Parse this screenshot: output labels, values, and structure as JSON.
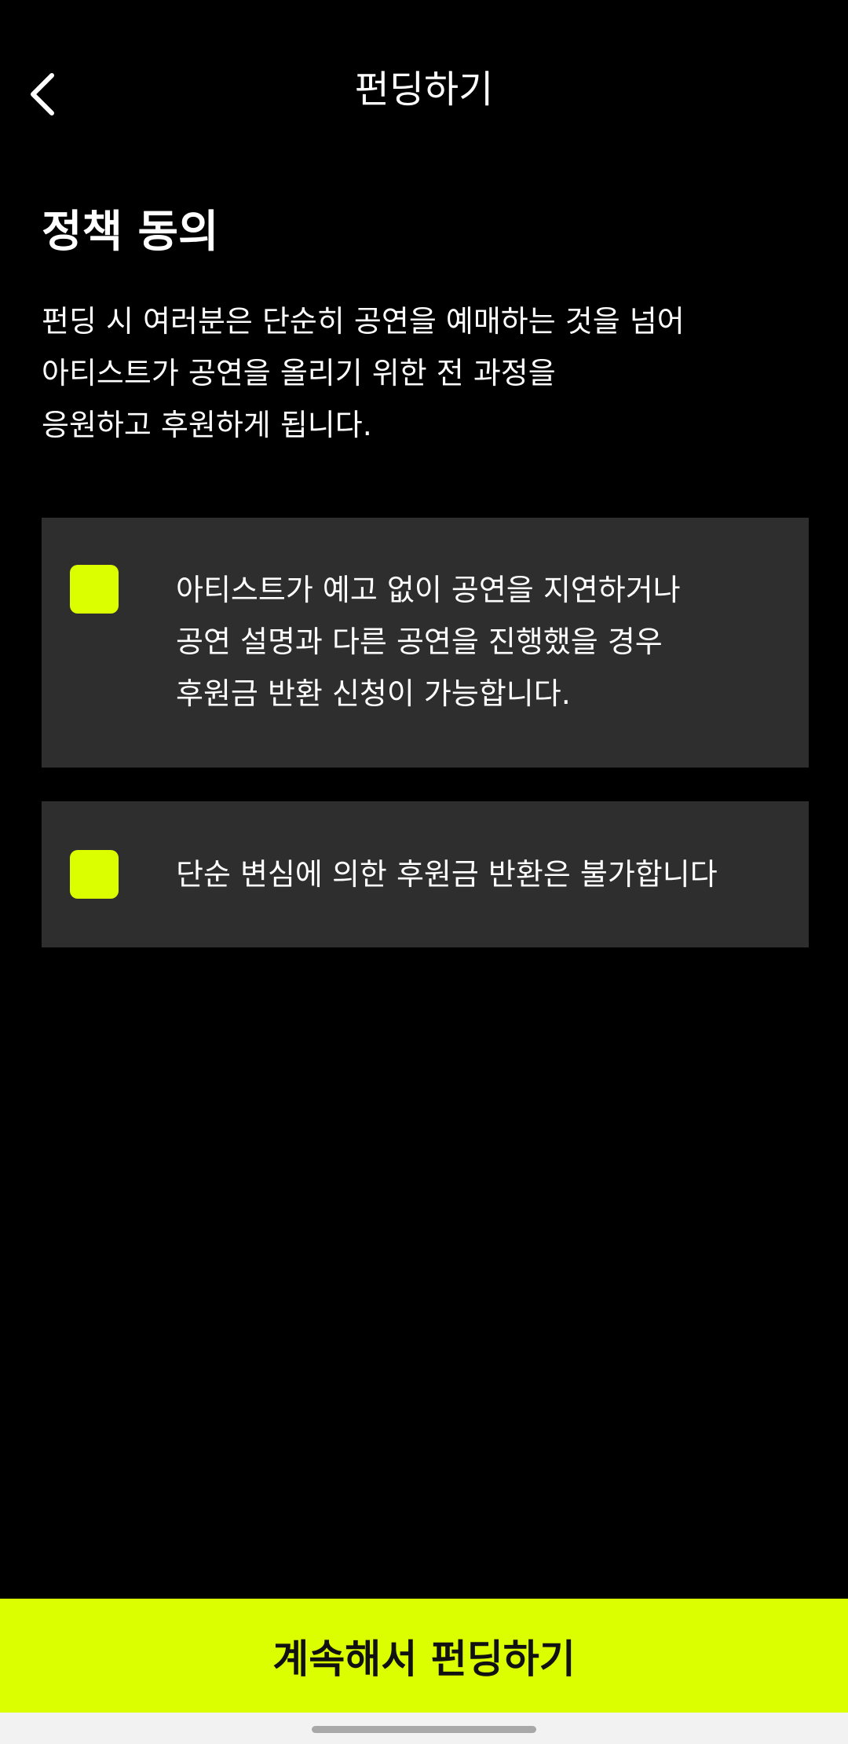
{
  "header": {
    "title": "펀딩하기",
    "back_icon": "chevron-left-icon"
  },
  "policy": {
    "heading": "정책 동의",
    "intro_lines": [
      "펀딩 시 여러분은 단순히 공연을 예매하는 것을 넘어",
      "아티스트가 공연을 올리기 위한 전 과정을",
      "응원하고 후원하게 됩니다."
    ],
    "items": [
      {
        "checked": false,
        "lines": [
          "아티스트가 예고 없이 공연을 지연하거나",
          "공연 설명과 다른 공연을 진행했을 경우",
          "후원금 반환 신청이 가능합니다."
        ]
      },
      {
        "checked": false,
        "lines": [
          "단순 변심에 의한 후원금 반환은 불가합니다"
        ]
      }
    ]
  },
  "cta": {
    "label": "계속해서 펀딩하기"
  },
  "colors": {
    "background": "#000000",
    "accent": "#dcff00",
    "card": "#2e2e2e",
    "text": "#ffffff",
    "cta_text": "#111111"
  }
}
